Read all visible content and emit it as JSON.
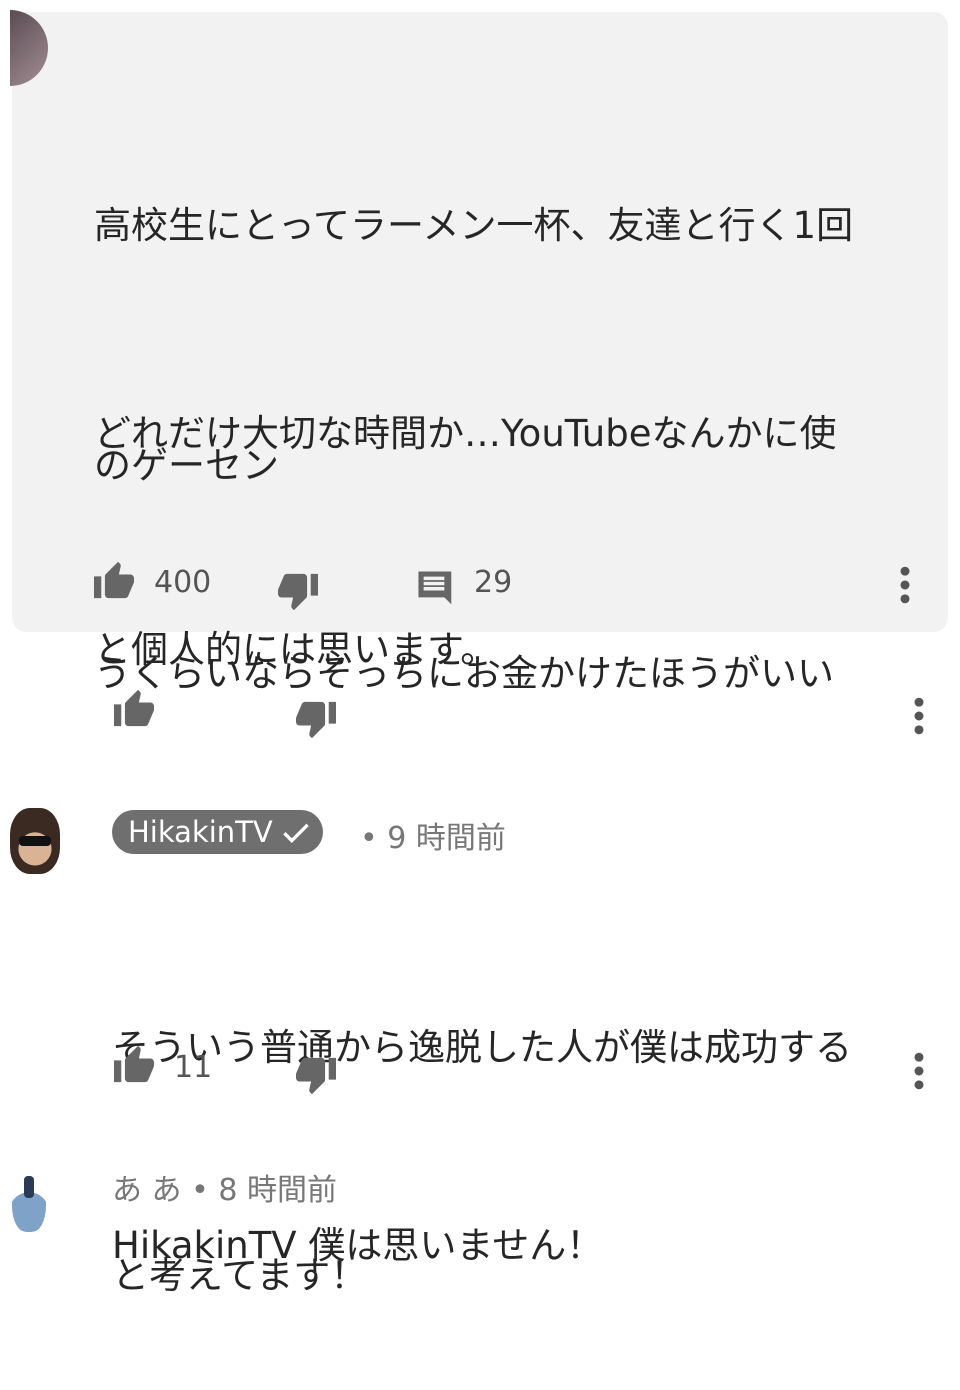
{
  "thread": {
    "parent": {
      "text_lines": [
        "高校生にとってラーメン一杯、友達と行く1回",
        "のゲーセン"
      ],
      "text_lines_2": [
        "どれだけ大切な時間か…YouTubeなんかに使",
        "うくらいならそっちにお金かけたほうがいい"
      ],
      "text_lines_3": [
        "と個人的には思います。"
      ],
      "likes": "400",
      "replies": "29"
    },
    "reply1": {
      "author": "HikakinTV",
      "time": "• 9 時間前",
      "text_line1": "そういう普通から逸脱した人が僕は成功する",
      "text_line2": "と考えてます！",
      "likes": "11"
    },
    "reply2": {
      "author": "あ あ",
      "time": "• 8 時間前",
      "text": "HikakinTV 僕は思いません！"
    }
  },
  "icons": {
    "like": "thumb-up-icon",
    "dislike": "thumb-down-icon",
    "reply": "comment-icon",
    "menu": "more-vert-icon",
    "verified": "check-icon"
  }
}
